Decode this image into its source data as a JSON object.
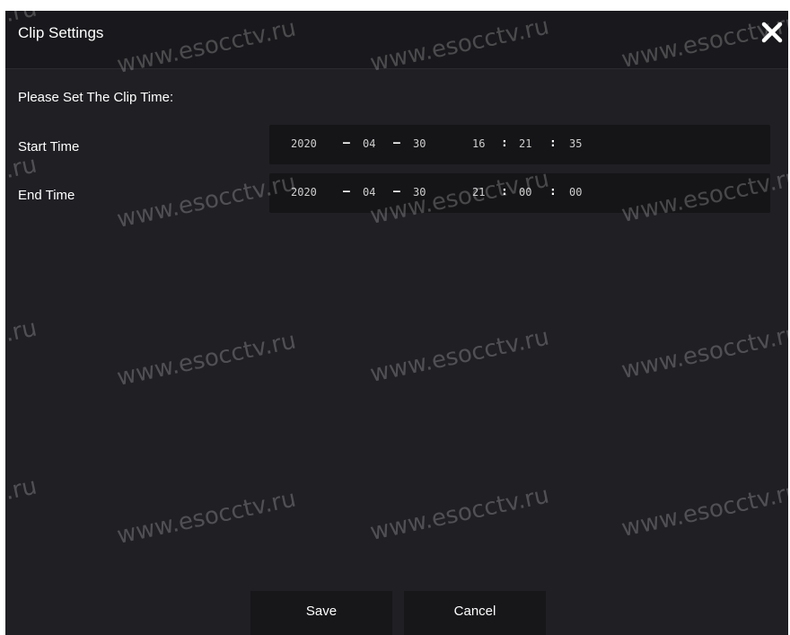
{
  "dialog": {
    "title": "Clip Settings",
    "close_icon": "close-icon",
    "prompt": "Please Set The Clip Time:"
  },
  "start": {
    "label": "Start Time",
    "year": "2020",
    "month": "04",
    "day": "30",
    "hour": "16",
    "minute": "21",
    "second": "35"
  },
  "end": {
    "label": "End Time",
    "year": "2020",
    "month": "04",
    "day": "30",
    "hour": "21",
    "minute": "00",
    "second": "00"
  },
  "buttons": {
    "save": "Save",
    "cancel": "Cancel"
  },
  "watermark": {
    "main": "www.esocctv.ru",
    "partial": "tv.ru"
  },
  "colors": {
    "background": "#1f1f24",
    "titlebar": "#19191d",
    "field": "#151518"
  }
}
